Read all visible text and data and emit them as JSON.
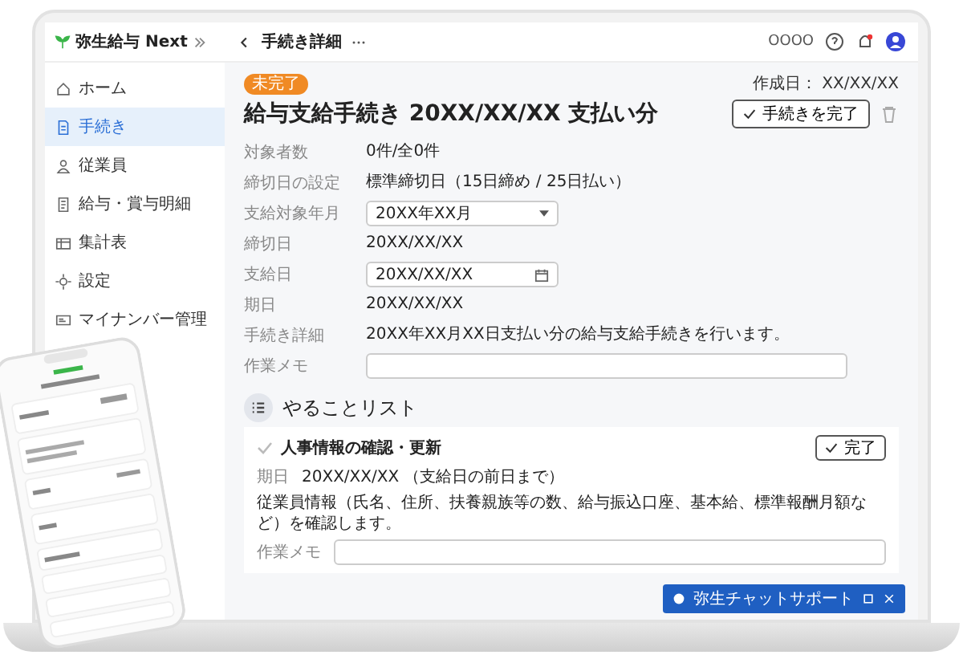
{
  "app": {
    "logo": "弥生給与 Next",
    "page_title": "手続き詳細",
    "company": "OOOO"
  },
  "sidebar": {
    "items": [
      {
        "label": "ホーム",
        "selected": false
      },
      {
        "label": "手続き",
        "selected": true
      },
      {
        "label": "従業員",
        "selected": false
      },
      {
        "label": "給与・賞与明細",
        "selected": false
      },
      {
        "label": "集計表",
        "selected": false
      },
      {
        "label": "設定",
        "selected": false
      },
      {
        "label": "マイナンバー管理",
        "selected": false
      }
    ]
  },
  "procedure": {
    "status": "未完了",
    "completed": false,
    "created_label": "作成日：",
    "created": "XX/XX/XX",
    "title": "給与支給手続き 20XX/XX/XX 支払い分",
    "complete_button": "手続きを完了",
    "fields": [
      {
        "kind": "text",
        "label": "対象者数",
        "value": "0件/全0件"
      },
      {
        "kind": "text",
        "label": "締切日の設定",
        "value": "標準締切日（15日締め / 25日払い）"
      },
      {
        "kind": "select",
        "label": "支給対象年月",
        "value": "20XX年XX月"
      },
      {
        "kind": "text",
        "label": "締切日",
        "value": "20XX/XX/XX"
      },
      {
        "kind": "date",
        "label": "支給日",
        "value": "20XX/XX/XX"
      },
      {
        "kind": "text",
        "label": "期日",
        "value": "20XX/XX/XX"
      },
      {
        "kind": "text",
        "label": "手続き詳細",
        "value": "20XX年XX月XX日支払い分の給与支給手続きを行います。"
      },
      {
        "kind": "input",
        "label": "作業メモ"
      }
    ]
  },
  "todo": {
    "heading": "やることリスト",
    "items": [
      {
        "title": "人事情報の確認・更新",
        "done": false,
        "button": "完了",
        "due_label": "期日",
        "due": "20XX/XX/XX",
        "due_note": "（支給日の前日まで）",
        "description": "従業員情報（氏名、住所、扶養親族等の数、給与振込口座、基本給、標準報酬月額など）を確認します。",
        "memo_label": "作業メモ"
      }
    ]
  },
  "chat": {
    "label": "弥生チャットサポート"
  }
}
